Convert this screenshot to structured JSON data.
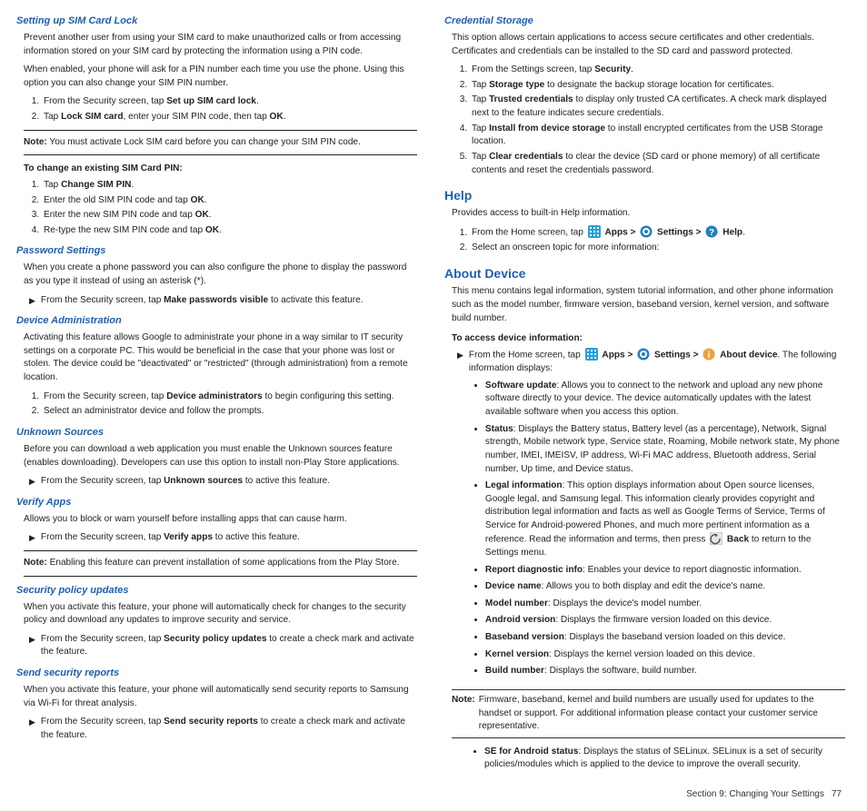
{
  "left": {
    "simlock": {
      "h": "Setting up SIM Card Lock",
      "p1": "Prevent another user from using your SIM card to make unauthorized calls or from accessing information stored on your SIM card by protecting the information using a PIN code.",
      "p2": "When enabled, your phone will ask for a PIN number each time you use the phone. Using this option you can also change your SIM PIN number.",
      "ol1a": "From the Security screen, tap ",
      "ol1b": "Set up SIM card lock",
      "ol1c": ".",
      "ol2a": "Tap ",
      "ol2b": "Lock SIM card",
      "ol2c": ", enter your SIM PIN code, then tap ",
      "ol2d": "OK",
      "ol2e": ".",
      "noteLab": "Note:",
      "note": " You must activate Lock SIM card before you can change your SIM PIN code.",
      "changeH": "To change an existing SIM Card PIN:",
      "c1a": "Tap ",
      "c1b": "Change SIM PIN",
      "c1c": ".",
      "c2a": "Enter the old SIM PIN code and tap ",
      "c2b": "OK",
      "c2c": ".",
      "c3a": "Enter the new SIM PIN code and tap ",
      "c3b": "OK",
      "c3c": ".",
      "c4a": "Re-type the new SIM PIN code and tap ",
      "c4b": "OK",
      "c4c": "."
    },
    "pwd": {
      "h": "Password Settings",
      "p": "When you create a phone password you can also configure the phone to display the password as you type it instead of using an asterisk (*).",
      "aa": "From the Security screen, tap ",
      "ab": "Make passwords visible",
      "ac": " to activate this feature."
    },
    "admin": {
      "h": "Device Administration",
      "p": "Activating this feature allows Google to administrate your phone in a way similar to IT security settings on a corporate PC. This would be beneficial in the case that your phone was lost or stolen. The device could be \"deactivated\" or \"restricted\" (through administration) from a remote location.",
      "o1a": "From the Security screen, tap ",
      "o1b": "Device administrators",
      "o1c": " to begin configuring this setting.",
      "o2": "Select an administrator device and follow the prompts."
    },
    "unk": {
      "h": "Unknown Sources",
      "p": "Before you can download a web application you must enable the Unknown sources feature (enables downloading). Developers can use this option to install non-Play Store applications.",
      "aa": "From the Security screen, tap ",
      "ab": "Unknown sources",
      "ac": " to active this feature."
    },
    "ver": {
      "h": "Verify Apps",
      "p": "Allows you to block or warn yourself before installing apps that can cause harm.",
      "aa": "From the Security screen, tap ",
      "ab": "Verify apps",
      "ac": " to active this feature.",
      "noteLab": "Note:",
      "note": " Enabling this feature can prevent installation of some applications from the Play Store."
    },
    "pol": {
      "h": "Security policy updates",
      "p": "When you activate this feature, your phone will automatically check for changes to the security policy and download any updates to improve security and service.",
      "aa": "From the Security screen, tap ",
      "ab": "Security policy updates",
      "ac": " to create a check mark and activate the feature."
    },
    "rep": {
      "h": "Send security reports",
      "p": "When you activate this feature, your phone will automatically send security reports to Samsung via Wi-Fi for threat analysis.",
      "aa": "From the Security screen, tap ",
      "ab": "Send security reports",
      "ac": " to create a check mark and activate the feature."
    }
  },
  "right": {
    "cred": {
      "h": "Credential Storage",
      "p": "This option allows certain applications to access secure certificates and other credentials. Certificates and credentials can be installed to the SD card and password protected.",
      "o1a": "From the Settings screen, tap ",
      "o1b": "Security",
      "o1c": ".",
      "o2a": "Tap ",
      "o2b": "Storage type",
      "o2c": " to designate the backup storage location for certificates.",
      "o3a": "Tap ",
      "o3b": "Trusted credentials",
      "o3c": " to display only trusted CA certificates. A check mark displayed next to the feature indicates secure credentials.",
      "o4a": "Tap ",
      "o4b": "Install from device storage",
      "o4c": " to install encrypted certificates from the USB Storage location.",
      "o5a": "Tap ",
      "o5b": "Clear credentials",
      "o5c": " to clear the device (SD card or phone memory) of all certificate contents and reset the credentials password."
    },
    "help": {
      "h": "Help",
      "p": "Provides access to built-in Help information.",
      "o1a": "From the Home screen, tap ",
      "apps": "Apps > ",
      "settings": "Settings > ",
      "helplab": "Help",
      "dot": ".",
      "o2": "Select an onscreen topic for more information:"
    },
    "about": {
      "h": "About Device",
      "p": "This menu contains legal information, system tutorial information, and other phone information such as the model number, firmware version, baseband version, kernel version, and software build number.",
      "accessH": "To access device information:",
      "aa": "From the Home screen, tap ",
      "apps": "Apps > ",
      "settings": "Settings > ",
      "aboutLab": "About device",
      "atail": ". The following information displays:",
      "b_su_l": "Software update",
      "b_su_t": ": Allows you to connect to the network and upload any new phone software directly to your device. The device automatically updates with the latest available software when you access this option.",
      "b_st_l": "Status",
      "b_st_t": ": Displays the Battery status, Battery level (as a percentage), Network, Signal strength, Mobile network type, Service state, Roaming, Mobile network state, My phone number, IMEI, IMEISV, IP address, Wi-Fi MAC address, Bluetooth address, Serial number, Up time, and Device status.",
      "b_li_l": "Legal information",
      "b_li_t1": ": This option displays information about Open source licenses, Google legal, and Samsung legal. This information clearly provides copyright and distribution legal information and facts as well as Google Terms of Service, Terms of Service for Android-powered Phones, and much more pertinent information as a reference. Read the information and terms, then press ",
      "b_li_back": "Back",
      "b_li_t2": " to return to the Settings menu.",
      "b_rd_l": "Report diagnostic info",
      "b_rd_t": ": Enables your device to report diagnostic information.",
      "b_dn_l": "Device name",
      "b_dn_t": ": Allows you to both display and edit the device's name.",
      "b_mn_l": "Model number",
      "b_mn_t": ": Displays the device's model number.",
      "b_av_l": "Android version",
      "b_av_t": ": Displays the firmware version loaded on this device.",
      "b_bv_l": "Baseband version",
      "b_bv_t": ": Displays the baseband version loaded on this device.",
      "b_kv_l": "Kernel version",
      "b_kv_t": ": Displays the kernel version loaded on this device.",
      "b_bn_l": "Build number",
      "b_bn_t": ": Displays the software, build number.",
      "noteLab": "Note:",
      "note": " Firmware, baseband, kernel and build numbers are usually used for updates to the handset or support. For additional information please contact your customer service representative.",
      "b_se_l": "SE for Android status",
      "b_se_t": ": Displays the status of SELinux. SELinux is a set of security policies/modules which is applied to the device to improve the overall security."
    }
  },
  "footer": {
    "section": "Section 9:  Changing Your Settings",
    "page": "77"
  }
}
